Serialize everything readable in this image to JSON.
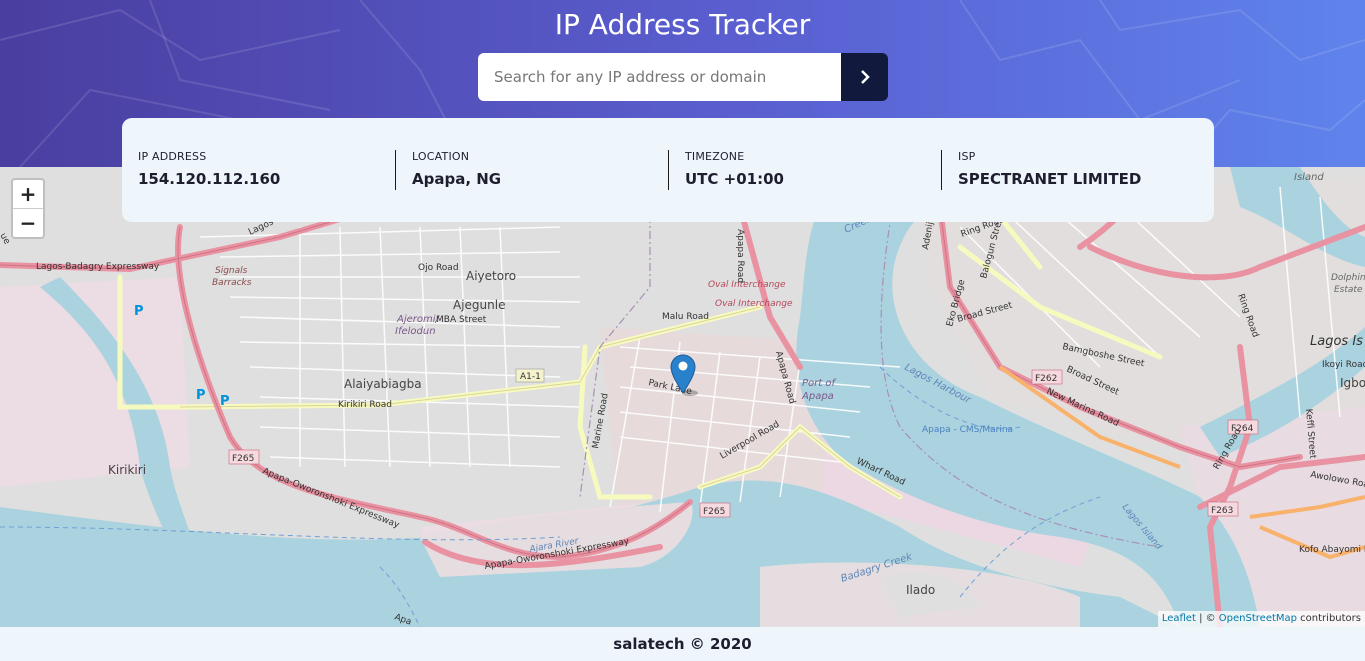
{
  "header": {
    "title": "IP Address Tracker",
    "search_placeholder": "Search for any IP address or domain",
    "search_value": "",
    "submit_icon": "chevron-right-icon"
  },
  "info": [
    {
      "label": "IP ADDRESS",
      "value": "154.120.112.160"
    },
    {
      "label": "LOCATION",
      "value": "Apapa, NG"
    },
    {
      "label": "TIMEZONE",
      "value": "UTC +01:00"
    },
    {
      "label": "ISP",
      "value": "SPECTRANET LIMITED"
    }
  ],
  "map": {
    "zoom_in": "+",
    "zoom_out": "−",
    "marker_icon": "map-pin-icon",
    "labels": {
      "lagos_badagry": "Lagos-Badagry Expressway",
      "signals": "Signals",
      "barracks": "Barracks",
      "ojo_road": "Ojo Road",
      "aiyetoro": "Aiyetoro",
      "ajegunle": "Ajegunle",
      "ajeromi": "Ajeromi/",
      "ifelodun": "Ifelodun",
      "mba_street": "MBA Street",
      "malu_road": "Malu Road",
      "a1_1": "A1-1",
      "alaiyabiagba": "Alaiyabiagba",
      "kirikiri_road": "Kirikiri Road",
      "kirikiri": "Kirikiri",
      "f265a": "F265",
      "apapa_oworonshoki1": "Apapa-Oworonshoki Expressway",
      "apapa_oworonshoki2": "Apapa-Oworonshoki Expressway",
      "ajara_river": "Ajara River",
      "marine_road": "Marine Road",
      "park_lane": "Park Lane",
      "liverpool_road": "Liverpool Road",
      "f265b": "F265",
      "oval_interchange1": "Oval Interchange",
      "oval_interchange2": "Oval Interchange",
      "apapa_road1": "Apapa Road",
      "apapa_road2": "Apapa Road",
      "port_of": "Port of",
      "apapa": "Apapa",
      "wharf_road": "Wharf Road",
      "lagos_harbour": "Lagos Harbour",
      "apapa_cms": "Apapa - CMS/Marina",
      "badagry_creek": "Badagry Creek",
      "ilado": "Ilado",
      "lagos_island_label": "Lagos Island",
      "creek": "Creek",
      "adeniji": "Adeniji Adele Road",
      "ring_road1": "Ring Road",
      "balogun": "Balogun Street",
      "eko_bridge": "Eko Bridge",
      "broad_street1": "Broad Street",
      "bamgboshe": "Bamgboshe Street",
      "f262": "F262",
      "broad_street2": "Broad Street",
      "new_marina": "New Marina Road",
      "ring_road2": "Ring Road",
      "f264": "F264",
      "ring_road3": "Ring Road",
      "f263": "F263",
      "lagos_is": "Lagos Is",
      "island": "Island",
      "dolphin": "Dolphin",
      "estate": "Estate",
      "igbo": "Igbo",
      "ikoyi_road": "Ikoyi Road",
      "keffi": "Keffi Street",
      "awolowo": "Awolowo Road",
      "kofo": "Kofo Abayomi R",
      "p1": "P",
      "p2": "P",
      "p3": "P",
      "lagos_island_river": "Lagos Island",
      "ue": "ue",
      "lagos_top": "Lagos",
      "apapa_bottom": "Apa"
    }
  },
  "attribution": {
    "leaflet": "Leaflet",
    "sep": " | © ",
    "osm": "OpenStreetMap",
    "rest": " contributors"
  },
  "footer": {
    "text": "salatech © 2020"
  },
  "colors": {
    "header_start": "#4a3ea0",
    "header_end": "#5f83ec",
    "button": "#111a3d",
    "water": "#aad3df",
    "motorway": "#e892a2",
    "primary": "#f7fabf",
    "marker": "#2a81cb"
  }
}
